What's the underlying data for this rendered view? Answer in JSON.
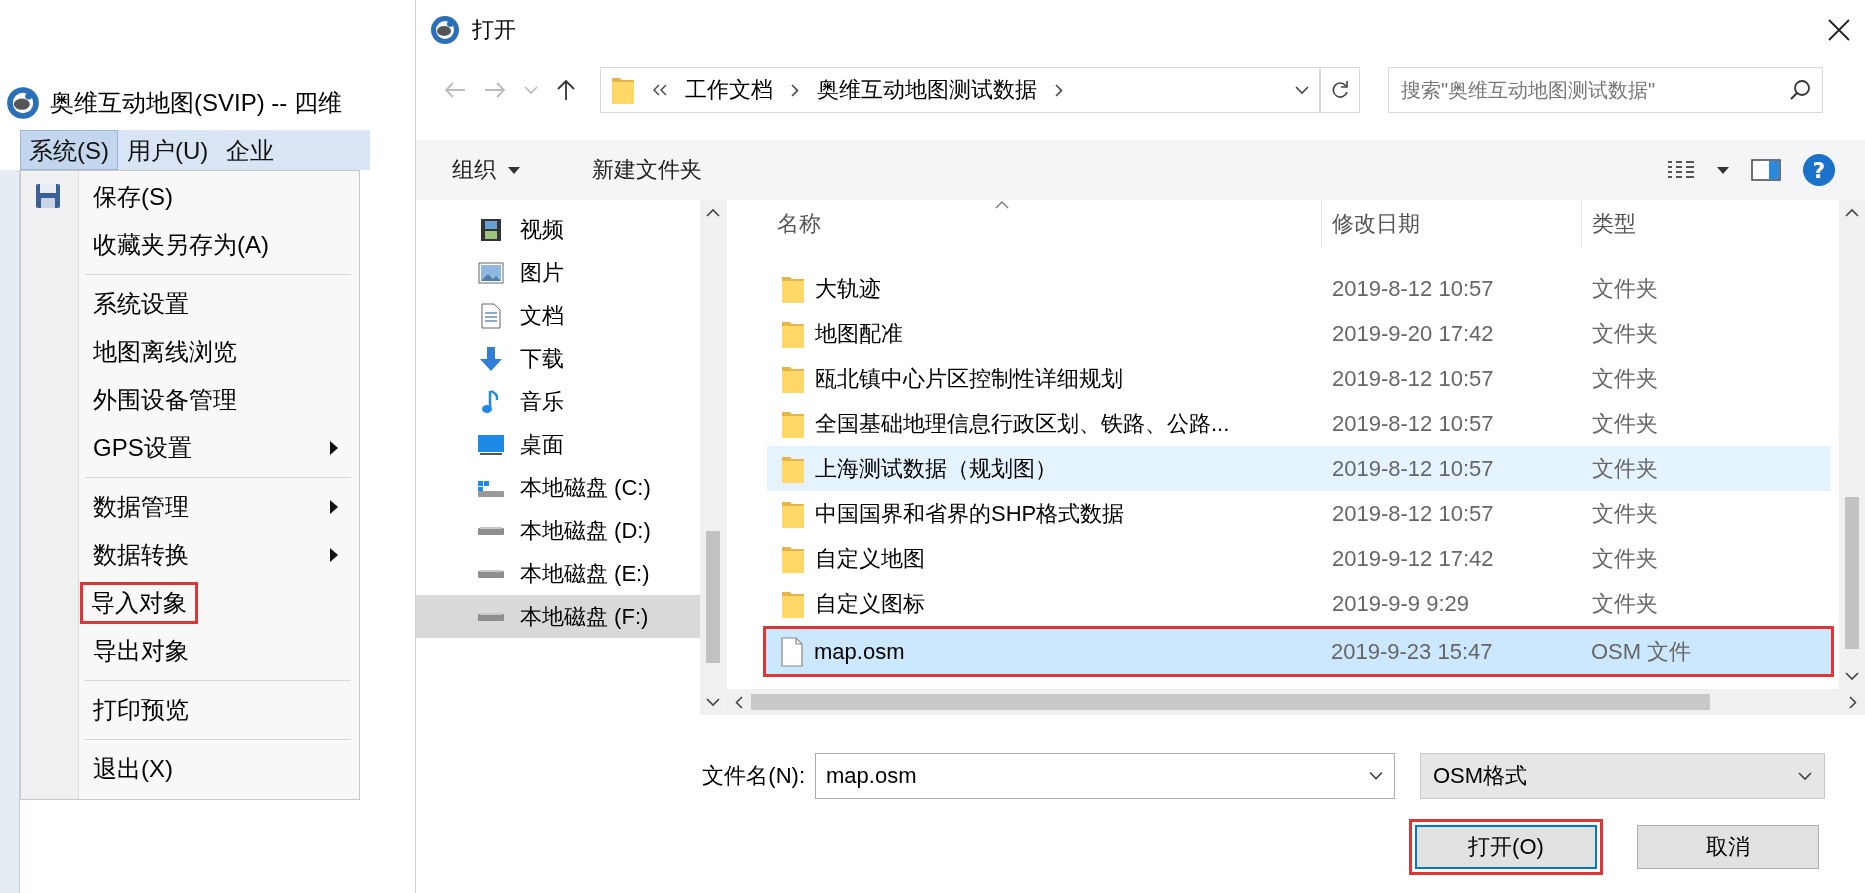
{
  "app": {
    "title": "奥维互动地图(SVIP) -- 四维",
    "menubar": [
      {
        "label": "系统(S)",
        "selected": true
      },
      {
        "label": "用户(U)",
        "selected": false
      },
      {
        "label": "企业",
        "selected": false
      }
    ],
    "menu": [
      {
        "kind": "item",
        "label": "保存(S)",
        "submenu": false,
        "annotated": false
      },
      {
        "kind": "item",
        "label": "收藏夹另存为(A)",
        "submenu": false,
        "annotated": false
      },
      {
        "kind": "separator"
      },
      {
        "kind": "item",
        "label": "系统设置",
        "submenu": false,
        "annotated": false
      },
      {
        "kind": "item",
        "label": "地图离线浏览",
        "submenu": false,
        "annotated": false
      },
      {
        "kind": "item",
        "label": "外围设备管理",
        "submenu": false,
        "annotated": false
      },
      {
        "kind": "item",
        "label": "GPS设置",
        "submenu": true,
        "annotated": false
      },
      {
        "kind": "separator"
      },
      {
        "kind": "item",
        "label": "数据管理",
        "submenu": true,
        "annotated": false
      },
      {
        "kind": "item",
        "label": "数据转换",
        "submenu": true,
        "annotated": false
      },
      {
        "kind": "item",
        "label": "导入对象",
        "submenu": false,
        "annotated": true
      },
      {
        "kind": "item",
        "label": "导出对象",
        "submenu": false,
        "annotated": false
      },
      {
        "kind": "separator"
      },
      {
        "kind": "item",
        "label": "打印预览",
        "submenu": false,
        "annotated": false
      },
      {
        "kind": "separator"
      },
      {
        "kind": "item",
        "label": "退出(X)",
        "submenu": false,
        "annotated": false
      }
    ]
  },
  "dialog": {
    "title": "打开",
    "path": [
      "工作文档",
      "奥维互动地图测试数据"
    ],
    "search": {
      "placeholder": "搜索\"奥维互动地图测试数据\""
    },
    "toolbar": [
      {
        "label": "组织",
        "menu": true
      },
      {
        "label": "新建文件夹",
        "menu": false
      }
    ],
    "help": "?",
    "nav": [
      {
        "label": "视频",
        "kind": "video",
        "selected": false
      },
      {
        "label": "图片",
        "kind": "picture",
        "selected": false
      },
      {
        "label": "文档",
        "kind": "document",
        "selected": false
      },
      {
        "label": "下载",
        "kind": "download",
        "selected": false
      },
      {
        "label": "音乐",
        "kind": "music",
        "selected": false
      },
      {
        "label": "桌面",
        "kind": "desktop",
        "selected": false
      },
      {
        "label": "本地磁盘 (C:)",
        "kind": "system-drive",
        "selected": false
      },
      {
        "label": "本地磁盘 (D:)",
        "kind": "drive",
        "selected": false
      },
      {
        "label": "本地磁盘 (E:)",
        "kind": "drive",
        "selected": false
      },
      {
        "label": "本地磁盘 (F:)",
        "kind": "drive",
        "selected": true
      }
    ],
    "columns": [
      "名称",
      "修改日期",
      "类型"
    ],
    "rows": [
      {
        "name": "大轨迹",
        "date": "2019-8-12 10:57",
        "type": "文件夹",
        "kind": "folder",
        "hovered": false,
        "selected": false,
        "annotated": false
      },
      {
        "name": "地图配准",
        "date": "2019-9-20 17:42",
        "type": "文件夹",
        "kind": "folder",
        "hovered": false,
        "selected": false,
        "annotated": false
      },
      {
        "name": "瓯北镇中心片区控制性详细规划",
        "date": "2019-8-12 10:57",
        "type": "文件夹",
        "kind": "folder",
        "hovered": false,
        "selected": false,
        "annotated": false
      },
      {
        "name": "全国基础地理信息行政区划、铁路、公路...",
        "date": "2019-8-12 10:57",
        "type": "文件夹",
        "kind": "folder",
        "hovered": false,
        "selected": false,
        "annotated": false
      },
      {
        "name": "上海测试数据（规划图）",
        "date": "2019-8-12 10:57",
        "type": "文件夹",
        "kind": "folder",
        "hovered": true,
        "selected": false,
        "annotated": false
      },
      {
        "name": "中国国界和省界的SHP格式数据",
        "date": "2019-8-12 10:57",
        "type": "文件夹",
        "kind": "folder",
        "hovered": false,
        "selected": false,
        "annotated": false
      },
      {
        "name": "自定义地图",
        "date": "2019-9-12 17:42",
        "type": "文件夹",
        "kind": "folder",
        "hovered": false,
        "selected": false,
        "annotated": false
      },
      {
        "name": "自定义图标",
        "date": "2019-9-9 9:29",
        "type": "文件夹",
        "kind": "folder",
        "hovered": false,
        "selected": false,
        "annotated": false
      },
      {
        "name": "map.osm",
        "date": "2019-9-23 15:47",
        "type": "OSM 文件",
        "kind": "file",
        "hovered": false,
        "selected": true,
        "annotated": true
      }
    ],
    "filename": {
      "label": "文件名(N):",
      "value": "map.osm"
    },
    "filetype": {
      "value": "OSM格式"
    },
    "buttons": [
      {
        "label": "打开(O)",
        "default": true,
        "annotated": true
      },
      {
        "label": "取消",
        "default": false,
        "annotated": false
      }
    ]
  }
}
